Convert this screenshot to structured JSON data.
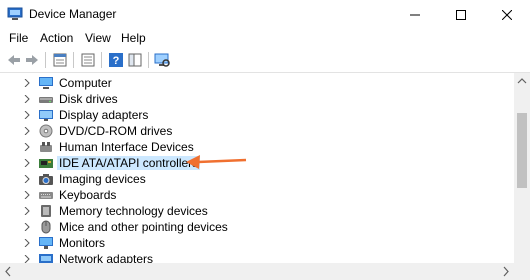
{
  "window": {
    "title": "Device Manager"
  },
  "menu": {
    "items": [
      "File",
      "Action",
      "View",
      "Help"
    ]
  },
  "toolbar": {
    "icons": [
      "back-icon",
      "forward-icon",
      "properties-icon",
      "console-tree-icon",
      "help-icon",
      "monitor-scan-icon"
    ]
  },
  "tree": {
    "items": [
      {
        "label": "Computer",
        "icon": "computer-icon"
      },
      {
        "label": "Disk drives",
        "icon": "disk-drive-icon"
      },
      {
        "label": "Display adapters",
        "icon": "display-adapter-icon"
      },
      {
        "label": "DVD/CD-ROM drives",
        "icon": "dvd-drive-icon"
      },
      {
        "label": "Human Interface Devices",
        "icon": "hid-icon"
      },
      {
        "label": "IDE ATA/ATAPI controllers",
        "icon": "ide-controller-icon",
        "selected": true
      },
      {
        "label": "Imaging devices",
        "icon": "camera-icon"
      },
      {
        "label": "Keyboards",
        "icon": "keyboard-icon"
      },
      {
        "label": "Memory technology devices",
        "icon": "memory-icon"
      },
      {
        "label": "Mice and other pointing devices",
        "icon": "mouse-icon"
      },
      {
        "label": "Monitors",
        "icon": "monitor-icon"
      },
      {
        "label": "Network adapters",
        "icon": "network-icon"
      }
    ]
  },
  "colors": {
    "selection": "#cce8ff",
    "annotation_arrow": "#f07030",
    "icon_blue": "#2a6fc9"
  }
}
